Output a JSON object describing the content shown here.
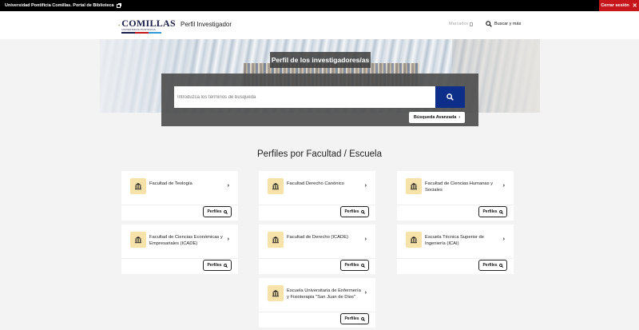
{
  "topbar": {
    "portal_label": "Universidad Pontificia Comillas. Portal de Biblioteca",
    "logout_label": "Cerrar sesión"
  },
  "header": {
    "logo_name": "COMILLAS",
    "logo_sub": "UNIVERSIDAD PONTIFICIA",
    "site_title": "Perfil Investigador",
    "marcados_label": "Marcados",
    "search_more_label": "Buscar y más"
  },
  "hero": {
    "title": "Perfil de los investigadores/as",
    "search_placeholder": "Introduzca los términos de búsqueda",
    "advanced_label": "Búsqueda Avanzada"
  },
  "section": {
    "title": "Perfiles por Facultad / Escuela"
  },
  "cards": [
    {
      "name": "Facultad de Teología",
      "button": "Perfiles"
    },
    {
      "name": "Facultad Derecho Canónico",
      "button": "Perfiles"
    },
    {
      "name": "Facultad de Ciencias Humanas y Sociales",
      "button": "Perfiles"
    },
    {
      "name": "Facultad de Ciencias Económicas y Empresariales (ICADE)",
      "button": "Perfiles"
    },
    {
      "name": "Facultad de Derecho (ICADE)",
      "button": "Perfiles"
    },
    {
      "name": "Escuela Técnica Superior de Ingeniería (ICAI)",
      "button": "Perfiles"
    },
    {
      "name": "Escuela Universitaria de Enfermería y Fisioterapia \"San Juan de Dios\"",
      "button": "Perfiles"
    }
  ],
  "icons": {
    "faculty": "institution-icon",
    "search": "magnifier-icon",
    "chevron": "chevron-right-icon"
  },
  "colors": {
    "topbar": "#000000",
    "logout": "#c7161b",
    "search_button": "#0d2f8a",
    "icon_box": "#f7e3a9"
  }
}
